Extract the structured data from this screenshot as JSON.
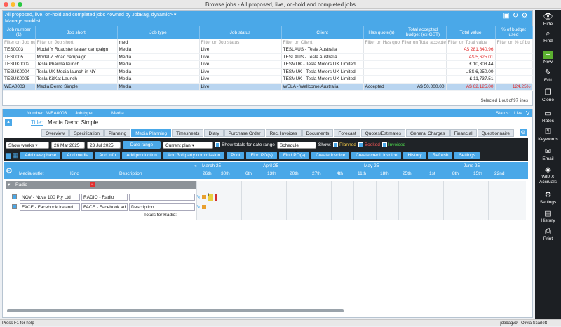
{
  "window": {
    "title": "Browse jobs - All proposed, live, on-hold and completed jobs"
  },
  "upper": {
    "filter_title": "All proposed, live, on-hold and completed jobs <owned by JobBag, dynamic>",
    "manage_worklist": "Manage worklist",
    "columns": [
      "Job number (1)",
      "Job short",
      "Job type",
      "Job status",
      "Client",
      "Has quote(s)",
      "Total accepted budget (ex-GST)",
      "Total value",
      "% of budget used"
    ],
    "filters": [
      "Filter on Job numb",
      "Filter on Job short",
      "med",
      "Filter on Job status",
      "Filter on Client",
      "Filter on Has quo",
      "Filter on Total accepted b",
      "Filter on Total value",
      "Filter on % of bu"
    ],
    "rows": [
      [
        "TES0003",
        "Model Y Roadster teaser campaign",
        "Media",
        "Live",
        "TESLAUS - Tesla Australia",
        "",
        "",
        "A$ 281,840.96",
        ""
      ],
      [
        "TES0005",
        "Model Z Road campaign",
        "Media",
        "Live",
        "TESLAUS - Tesla Australia",
        "",
        "",
        "A$ 5,625.01",
        ""
      ],
      [
        "TESUK0002",
        "Tesla Pharma launch",
        "Media",
        "Live",
        "TESMUK - Tesla Motors UK Limited",
        "",
        "",
        "£ 10,303.44",
        ""
      ],
      [
        "TESUK0004",
        "Tesla UK Media launch in NY",
        "Media",
        "Live",
        "TESMUK - Tesla Motors UK Limited",
        "",
        "",
        "US$ 6,250.00",
        ""
      ],
      [
        "TESUK0005",
        "Tesla KitKat Launch",
        "Media",
        "Live",
        "TESMUK - Tesla Motors UK Limited",
        "",
        "",
        "£ 11,737.51",
        ""
      ],
      [
        "WEA0003",
        "Media Demo Simple",
        "Media",
        "Live",
        "WELA - Wellcome Australia",
        "Accepted",
        "A$ 50,000.00",
        "A$ 62,125.00",
        "124.25%"
      ]
    ],
    "selection_info": "Selected 1 out of 97 lines"
  },
  "job": {
    "number_label": "Number:",
    "number": "WEA0003",
    "type_label": "Job type:",
    "type": "Media",
    "status_label": "Status:",
    "status": "Live",
    "title_label": "Title:",
    "title": "Media Demo Simple"
  },
  "tabs": [
    "Overview",
    "Specification",
    "Planning",
    "Media Planning",
    "Timesheets",
    "Diary",
    "Purchase Order",
    "Rec. Invoices",
    "Documents",
    "Forecast",
    "Quotes/Estimates",
    "General Charges",
    "Financial",
    "Questionnaire"
  ],
  "toolbar": {
    "period": "Show weeks",
    "date_from": "26 Mar 2025",
    "date_to": "23 Jul 2025",
    "date_range_btn": "Date range",
    "plan": "Current plan",
    "show_totals": "Show totals for date range",
    "schedule": "Schedule curre...",
    "show_label": "Show:",
    "planned": "Planned",
    "booked": "Booked",
    "invoiced": "Invoiced",
    "buttons": [
      "Add new phase",
      "Add media",
      "Add info",
      "Add production",
      "Add 3rd party commission",
      "Print",
      "Find PO(s)",
      "Find PO(s)",
      "Create Invoice",
      "Create credit invoice",
      "History",
      "Refresh",
      "Settings"
    ]
  },
  "plan": {
    "col_outlet": "Media outlet",
    "col_kind": "Kind",
    "col_desc": "Description",
    "months": [
      "March 25",
      "April 25",
      "May 25",
      "June 25"
    ],
    "weeks": [
      "26th",
      "30th",
      "6th",
      "13th",
      "20th",
      "27th",
      "4th",
      "11th",
      "18th",
      "25th",
      "1st",
      "8th",
      "15th",
      "22nd"
    ],
    "group": "Radio",
    "rows": [
      {
        "outlet": "NOV - Nova 100 Pty Ltd",
        "kind": "RADIO - Radio",
        "desc": ""
      },
      {
        "outlet": "FACE - Facebook Ireland",
        "kind": "FACE - Facebook ad",
        "desc": "Description"
      }
    ],
    "totals": "Totals for  Radio:"
  },
  "sidebar": [
    "Hide",
    "Find",
    "New",
    "Edit",
    "Clone",
    "Rates",
    "Keywords",
    "Email",
    "WIP & Accruals",
    "Settings",
    "History",
    "Print"
  ],
  "status": {
    "left": "Press F1 for help",
    "right": "jobbagv9 - Olivia Scarlett"
  }
}
